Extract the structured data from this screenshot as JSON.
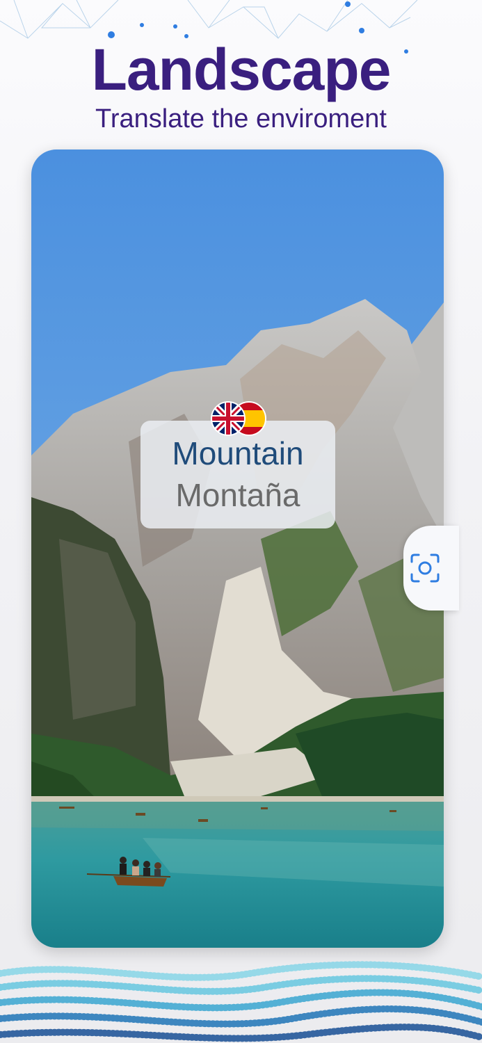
{
  "header": {
    "title": "Landscape",
    "subtitle": "Translate the enviroment"
  },
  "translation": {
    "source_word": "Mountain",
    "target_word": "Montaña",
    "source_flag": "uk-flag-icon",
    "target_flag": "spain-flag-icon"
  },
  "actions": {
    "capture_icon": "camera-scan-icon"
  },
  "colors": {
    "title": "#3a1f7f",
    "source_word": "#1f4b7a",
    "target_word": "#6a6a6a",
    "accent": "#2f7de1"
  }
}
